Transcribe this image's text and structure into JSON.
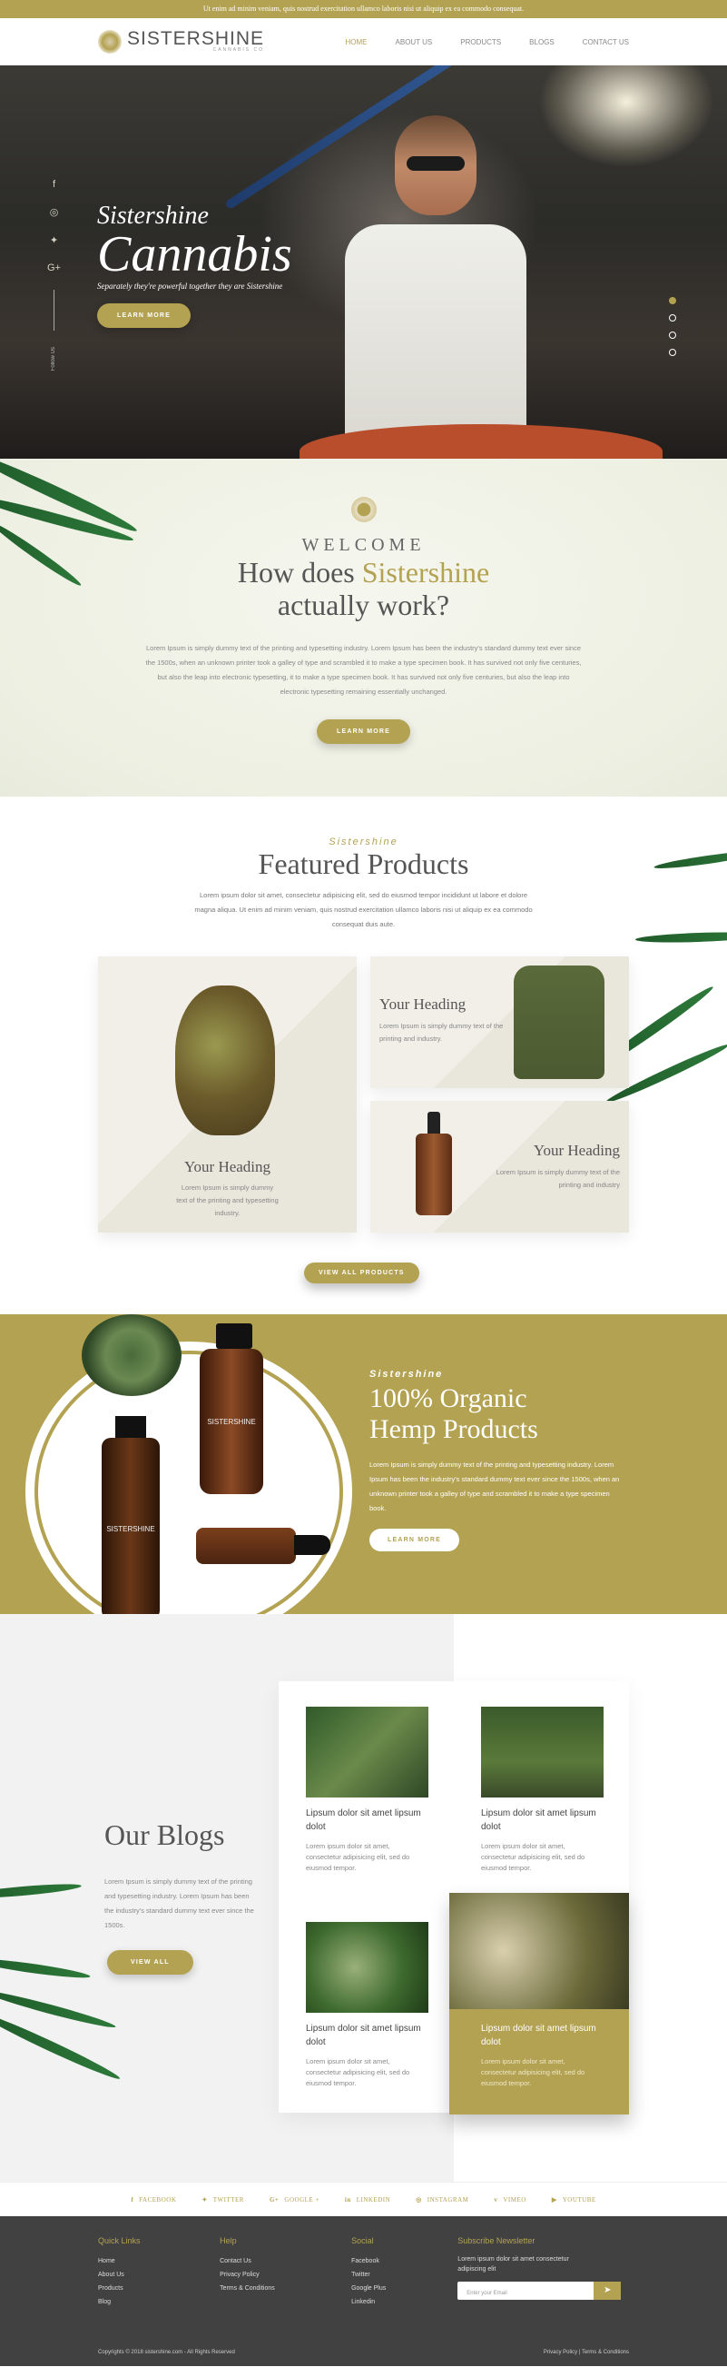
{
  "topbar": {
    "text": "Ut enim ad minim veniam, quis nostrud exercitation ullamco laboris nisi ut aliquip ex ea commodo consequat."
  },
  "header": {
    "logo_text": "SISTERSHINE",
    "logo_sub": "CANNABIS CO",
    "nav": [
      "HOME",
      "ABOUT US",
      "PRODUCTS",
      "BLOGS",
      "CONTACT US"
    ],
    "active": "HOME"
  },
  "hero": {
    "title_small": "Sistershine",
    "title_large": "Cannabis",
    "tagline": "Separately they're powerful together they are Sistershine",
    "cta": "LEARN MORE",
    "follow_label": "Follow Us",
    "slides": 4,
    "active_slide": 1
  },
  "welcome": {
    "kicker": "WELCOME",
    "heading_pre": "How does",
    "heading_accent": "Sistershine",
    "heading_post": "actually work?",
    "body": "Lorem Ipsum is simply dummy text of the printing and typesetting industry. Lorem Ipsum has been the industry's standard dummy text ever since the 1500s, when an unknown printer took a galley of type and scrambled it to make a type specimen book. It has survived not only five centuries, but also the leap into electronic typesetting, it to make a type specimen book. It has survived not only five centuries, but also the leap into electronic typesetting remaining essentially unchanged.",
    "cta": "LEARN MORE"
  },
  "featured": {
    "kicker": "Sistershine",
    "heading": "Featured Products",
    "intro": "Lorem ipsum dolor sit amet, consectetur adipisicing elit, sed do eiusmod tempor incididunt ut labore et dolore magna aliqua. Ut enim ad minim veniam, quis nostrud exercitation ullamco laboris nisi ut aliquip ex ea commodo consequat duis aute.",
    "cards": [
      {
        "heading": "Your Heading",
        "text": "Lorem Ipsum is simply dummy text of the printing and typesetting industry."
      },
      {
        "heading": "Your Heading",
        "text": "Lorem Ipsum is simply dummy text of the printing and industry."
      },
      {
        "heading": "Your Heading",
        "text": "Lorem Ipsum is simply dummy text of the printing and industry"
      }
    ],
    "cta": "VIEW ALL PRODUCTS"
  },
  "organic": {
    "kicker": "Sistershine",
    "heading_1": "100% Organic",
    "heading_2": "Hemp Products",
    "body": "Lorem Ipsum is simply dummy text of the printing and typesetting industry. Lorem Ipsum has been the industry's standard dummy text ever since the 1500s, when an unknown printer took a galley of type and scrambled it to make a type specimen book.",
    "cta": "LEARN MORE",
    "bottle_label": "SISTERSHINE"
  },
  "blogs": {
    "heading": "Our Blogs",
    "intro": "Lorem Ipsum is simply dummy text of the printing and typesetting industry. Lorem Ipsum has been the industry's standard dummy text ever since the 1500s.",
    "cta": "VIEW ALL",
    "posts": [
      {
        "title": "Lipsum dolor sit amet lipsum dolot",
        "text": "Lorem ipsum dolor sit amet, consectetur adipisicing elit, sed do eiusmod tempor."
      },
      {
        "title": "Lipsum dolor sit amet lipsum dolot",
        "text": "Lorem ipsum dolor sit amet, consectetur adipisicing elit, sed do eiusmod tempor."
      },
      {
        "title": "Lipsum dolor sit amet lipsum dolot",
        "text": "Lorem ipsum dolor sit amet, consectetur adipisicing elit, sed do eiusmod tempor."
      },
      {
        "title": "Lipsum dolor sit amet lipsum dolot",
        "text": "Lorem ipsum dolor sit amet, consectetur adipisicing elit, sed do eiusmod tempor."
      }
    ]
  },
  "social_links": [
    "FACEBOOK",
    "TWITTER",
    "GOOGLE +",
    "LINKEDIN",
    "INSTAGRAM",
    "VIMEO",
    "YOUTUBE"
  ],
  "footer": {
    "quick_links": {
      "title": "Quick Links",
      "items": [
        "Home",
        "About Us",
        "Products",
        "Blog"
      ]
    },
    "help": {
      "title": "Help",
      "items": [
        "Contact Us",
        "Privacy Policy",
        "Terms & Conditions"
      ]
    },
    "social": {
      "title": "Social",
      "items": [
        "Facebook",
        "Twitter",
        "Google Plus",
        "Linkedin"
      ]
    },
    "newsletter": {
      "title": "Subscribe Newsletter",
      "text": "Lorem ipsum dolor sit amet consectetur adipiscing elit",
      "placeholder": "Enter your Email"
    },
    "copyright": "Copyrights © 2018 sistershine.com - All Rights Reserved",
    "bottom_links": "Privacy Policy  |  Terms & Conditions"
  },
  "colors": {
    "accent": "#b3a252",
    "footer_bg": "#414141"
  }
}
